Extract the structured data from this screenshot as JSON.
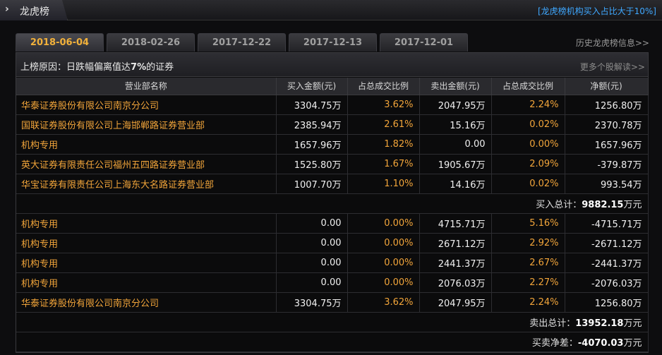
{
  "header": {
    "title": "龙虎榜",
    "right_link": "[龙虎榜机构买入占比大于10%]"
  },
  "tabs": [
    {
      "label": "2018-06-04",
      "active": true
    },
    {
      "label": "2018-02-26",
      "active": false
    },
    {
      "label": "2017-12-22",
      "active": false
    },
    {
      "label": "2017-12-13",
      "active": false
    },
    {
      "label": "2017-12-01",
      "active": false
    }
  ],
  "history_link": "历史龙虎榜信息>>",
  "reason": {
    "prefix": "上榜原因：",
    "text": "日跌幅偏离值达",
    "bold": "7%",
    "suffix": "的证券",
    "more": "更多个股解读>>"
  },
  "columns": [
    "营业部名称",
    "买入金额(元)",
    "占总成交比例",
    "卖出金额(元)",
    "占总成交比例",
    "净额(元)"
  ],
  "buy_rows": [
    [
      "华泰证券股份有限公司南京分公司",
      "3304.75万",
      "3.62%",
      "2047.95万",
      "2.24%",
      "1256.80万"
    ],
    [
      "国联证券股份有限公司上海邯郸路证券营业部",
      "2385.94万",
      "2.61%",
      "15.16万",
      "0.02%",
      "2370.78万"
    ],
    [
      "机构专用",
      "1657.96万",
      "1.82%",
      "0.00",
      "0.00%",
      "1657.96万"
    ],
    [
      "英大证券有限责任公司福州五四路证券营业部",
      "1525.80万",
      "1.67%",
      "1905.67万",
      "2.09%",
      "-379.87万"
    ],
    [
      "华宝证券有限责任公司上海东大名路证券营业部",
      "1007.70万",
      "1.10%",
      "14.16万",
      "0.02%",
      "993.54万"
    ]
  ],
  "buy_total": {
    "label": "买入总计：",
    "value": "9882.15",
    "unit": "万元"
  },
  "sell_rows": [
    [
      "机构专用",
      "0.00",
      "0.00%",
      "4715.71万",
      "5.16%",
      "-4715.71万"
    ],
    [
      "机构专用",
      "0.00",
      "0.00%",
      "2671.12万",
      "2.92%",
      "-2671.12万"
    ],
    [
      "机构专用",
      "0.00",
      "0.00%",
      "2441.37万",
      "2.67%",
      "-2441.37万"
    ],
    [
      "机构专用",
      "0.00",
      "0.00%",
      "2076.03万",
      "2.27%",
      "-2076.03万"
    ],
    [
      "华泰证券股份有限公司南京分公司",
      "3304.75万",
      "3.62%",
      "2047.95万",
      "2.24%",
      "1256.80万"
    ]
  ],
  "sell_total": {
    "label": "卖出总计：",
    "value": "13952.18",
    "unit": "万元"
  },
  "net_total": {
    "label": "买卖净差：",
    "value": "-4070.03",
    "unit": "万元"
  }
}
